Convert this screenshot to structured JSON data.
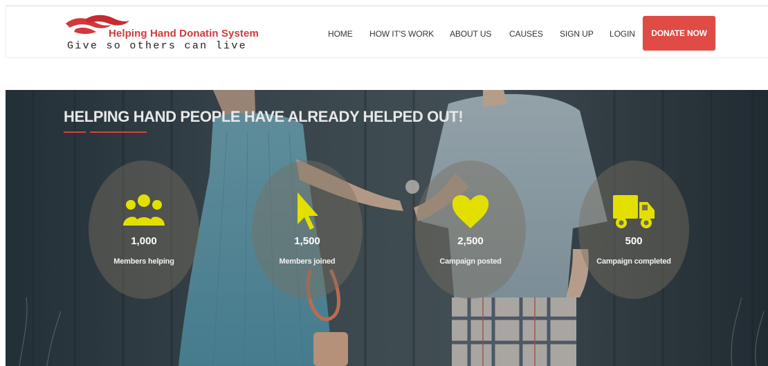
{
  "brand": {
    "title": "Helping Hand Donatin System",
    "tagline": "Give so others can live",
    "logo_icon": "red-hands-logo",
    "title_color": "#d2383b"
  },
  "nav": {
    "items": [
      {
        "label": "HOME"
      },
      {
        "label": "HOW IT'S WORK"
      },
      {
        "label": "ABOUT US"
      },
      {
        "label": "CAUSES"
      },
      {
        "label": "SIGN UP"
      },
      {
        "label": "LOGIN"
      }
    ],
    "cta_label": "DONATE NOW",
    "cta_color": "#e04b45"
  },
  "hero": {
    "title": "HELPING HAND PEOPLE HAVE ALREADY HELPED OUT!",
    "accent_color": "#d9423d",
    "icon_color": "#e3e000",
    "stats": [
      {
        "icon": "users-group-icon",
        "value": "1,000",
        "label": "Members helping"
      },
      {
        "icon": "cursor-pointer-icon",
        "value": "1,500",
        "label": "Members joined"
      },
      {
        "icon": "heart-icon",
        "value": "2,500",
        "label": "Campaign posted"
      },
      {
        "icon": "truck-icon",
        "value": "500",
        "label": "Campaign completed"
      }
    ]
  }
}
